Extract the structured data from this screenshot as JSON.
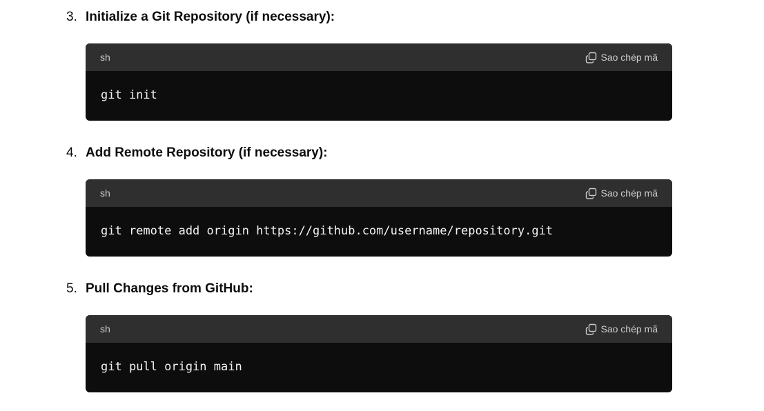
{
  "steps": [
    {
      "number": "3.",
      "title": "Initialize a Git Repository (if necessary):",
      "code": {
        "language": "sh",
        "copy_label": "Sao chép mã",
        "copy_icon": "copy-icon",
        "content": "git init"
      }
    },
    {
      "number": "4.",
      "title": "Add Remote Repository (if necessary):",
      "code": {
        "language": "sh",
        "copy_label": "Sao chép mã",
        "copy_icon": "copy-icon",
        "content": "git remote add origin https://github.com/username/repository.git"
      }
    },
    {
      "number": "5.",
      "title": "Pull Changes from GitHub:",
      "code": {
        "language": "sh",
        "copy_label": "Sao chép mã",
        "copy_icon": "copy-icon",
        "content": "git pull origin main"
      }
    }
  ],
  "colors": {
    "code_background": "#0d0d0d",
    "code_header_background": "#2f2f2f",
    "code_text": "#f2f2f2",
    "header_text": "#cdcdcd"
  }
}
